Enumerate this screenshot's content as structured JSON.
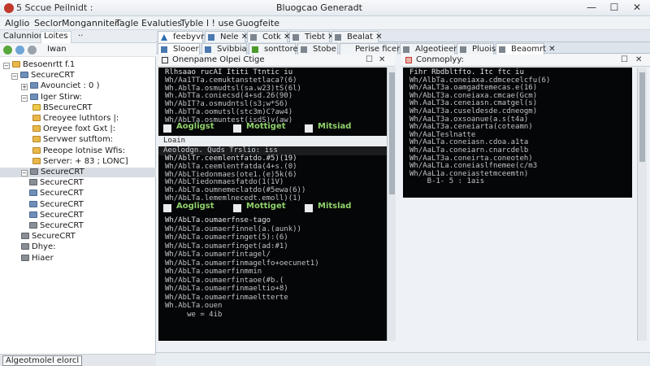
{
  "window": {
    "title_left": "5 Sccue Peilnidt :",
    "title_center": "Bluogcao Generadt",
    "buttons": {
      "minimize": "—",
      "maximize": "☐",
      "close": "✕"
    }
  },
  "menubar": {
    "items": [
      "Alglio",
      "Seclor",
      "Monganniter",
      "Tagle",
      "Evaluties",
      "Tyble",
      "l ! use",
      "Guogfeite"
    ]
  },
  "sidebar": {
    "tabs": [
      "Calunnion",
      "Loites",
      "··"
    ],
    "toolbar_label": "Iwan",
    "tree": [
      {
        "label": "Besoenrtt f.1",
        "icon": "folder",
        "toggle": "−"
      },
      {
        "label": "SecureCRT",
        "icon": "blue",
        "toggle": "−"
      },
      {
        "label": "Avounciet : 0 )",
        "icon": "blue",
        "toggle": "+"
      },
      {
        "label": "Iger Stirw:",
        "icon": "blue",
        "toggle": "−"
      },
      {
        "label": "BSecureCRT",
        "icon": "yellow",
        "toggle": ""
      },
      {
        "label": "Creoyee luthtors  |:",
        "icon": "folder",
        "toggle": ""
      },
      {
        "label": "Oreyee foxt Gxt  |:",
        "icon": "folder",
        "toggle": ""
      },
      {
        "label": "Servwer sutftom:",
        "icon": "folder",
        "toggle": ""
      },
      {
        "label": "Peeope lotnise Wfis:",
        "icon": "folder",
        "toggle": ""
      },
      {
        "label": "Server: + 83 ; LONC]",
        "icon": "folder",
        "toggle": ""
      },
      {
        "label": "SecureCRT",
        "icon": "gray",
        "toggle": "−"
      },
      {
        "label": "SecureCRT",
        "icon": "gray",
        "toggle": ""
      },
      {
        "label": "SecureCRT",
        "icon": "blue",
        "toggle": ""
      },
      {
        "label": "SecureCRT",
        "icon": "blue",
        "toggle": ""
      },
      {
        "label": "SecureCRT",
        "icon": "blue",
        "toggle": ""
      },
      {
        "label": "SecureCRT",
        "icon": "gray",
        "toggle": ""
      },
      {
        "label": "SecureCRT",
        "icon": "gray",
        "toggle": ""
      },
      {
        "label": "Dhye:",
        "icon": "gray",
        "toggle": ""
      },
      {
        "label": "Hiaer",
        "icon": "gray",
        "toggle": ""
      }
    ]
  },
  "tabs_row1": [
    {
      "label": "feebyvrs",
      "icon": "triangle",
      "active": true
    },
    {
      "label": "Nele ✕",
      "icon": "blue",
      "active": false
    },
    {
      "label": "Cotk ✕",
      "icon": "gray",
      "active": false
    },
    {
      "label": "Tiebt ✕",
      "icon": "gray",
      "active": false
    },
    {
      "label": "Bealat ✕",
      "icon": "gray",
      "active": false
    }
  ],
  "tabs_row2": [
    {
      "label": "Slooer",
      "icon": "blue",
      "active": true
    },
    {
      "label": "Svibbia",
      "icon": "blue",
      "active": false
    },
    {
      "label": "sonttore",
      "icon": "green",
      "active": false
    },
    {
      "label": "Stobe ✕",
      "icon": "gray",
      "active": false
    },
    {
      "label": "Perise ficere",
      "icon": "none",
      "active": false
    },
    {
      "label": "Algeotieent ✕",
      "icon": "gray",
      "active": false
    },
    {
      "label": "Pluoisfl",
      "icon": "gray",
      "active": false
    },
    {
      "label": "Beaomrt ✕",
      "icon": "gray",
      "active": true
    }
  ],
  "left_session": {
    "header": "Onenpame Olpei Ctige",
    "header_buttons": [
      "☐",
      "✕"
    ],
    "block1_lines": [
      "Rlhsaao rucAI Ititi Ttntic iu",
      "Wh/Aa1TTa.cemuktanstetlaca?(6)",
      "Wh.AblTa.osmudtsl(sa.w23)tS(6l)",
      "Wh.AbTTa.coniecsd(4+sd.26(90)",
      "Wh/AbIT?a.osmudntsl(s3;w*S6)",
      "Wh.AbTTa.oomutsl(stc3m)C?aw4)",
      "Wh/AbLTa.osmuntest(isdS)v(aw)"
    ],
    "status1": [
      "Aogligst",
      "Mottiget",
      "Mitsiad"
    ],
    "inner_header": "Loain",
    "inner_sub": "Aeolodgn. Quds Trslio: iss",
    "block2_lines": [
      "Wh/AblTr.ceemlentfatdo.#5)(19)",
      "Wh/AblTa.ceemlentfatda(4+s.(0)",
      "Wh/AbLTiedonmaes(ote1.(e)5k(6)",
      "Wh/AbLTiedonmaesfatdo(1(1V)",
      "Wh.AbLTa.oumnemeclatdo(#5ewa(6))",
      "Wh/AbLTa.lememlnecedt.emoll)(1)"
    ],
    "status2": [
      "Aogligst",
      "Mottiget",
      "Mitslad"
    ],
    "block3_lines": [
      "Wh/AbLTa.oumaerfnse-tago",
      "Wh/AbLTa.oumaerfinnel(a.(aunk))",
      "Wh/AbLTa.oumaerfinget(5):(6)",
      "Wh/AbLTa.oumaerfinget(ad:#1)",
      "Wh/AbLTa.oumaerfintagel/",
      "Wh/AbLTa.oumaerfinmagelfo+oecunet1)",
      "Wh/AbLTa.oumaerfinmmin",
      "Wh/AbLTa.oumaerfintaoe(#b.(",
      "Wh/AbLTa.oumaerfinmaeltio+8)",
      "Wh/AbLTa.oumaerfinmaeltterte",
      "Wh.AbLTa.ouen",
      "     we = 4ib"
    ]
  },
  "right_session": {
    "header": "Conmoplyy:",
    "header_buttons": [
      "☐",
      "✕"
    ],
    "lines": [
      "Fihr Rbdbltfto. Itc ftc iu",
      "Wh/AlbTa.coneiaxa.cdmcecelcfu(6)",
      "Wh/AaLT3a.oamgadtemecas.e(16)",
      "Wh/AbLT3a.coneiaxa.cmcae(Gcm)",
      "Wh.AaLT3a.ceneiasn.cmatgel(s)",
      "Wh/AaLT3a.cuseldesde.cdneogm)",
      "Wh/AaLT3a.oxsoanue(a.s(t4a)",
      "Wh/AaLT3a.ceneiarta(coteamn)",
      "Wh/AaLTeslnatte",
      "Wh/AaLTa.coneiasn.cdoa.a1ta",
      "Wh/AaLTa.coneiarn.cnarcdelb",
      "Wh/AaLT3a.coneirta.coneoteh)",
      "Wh/AaLTLa.coneiaslfnemee(c/m3",
      "Wh/AaL1a.coneiastetmceemtn)",
      "    B-1- 5 : 1ais"
    ]
  },
  "statusbar": {
    "text": "Algeotmolel elorcl"
  },
  "colors": {
    "accent": "#2f6fb0",
    "terminal_bg": "#050607",
    "status_green": "#8fd16a",
    "close_red": "#c0392b"
  }
}
